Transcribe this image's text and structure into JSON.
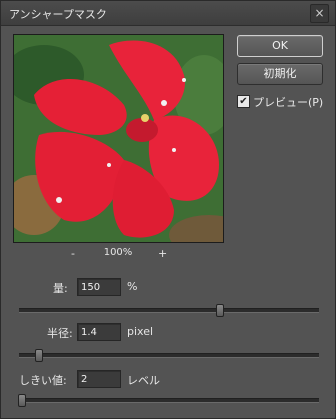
{
  "dialog": {
    "title": "アンシャープマスク",
    "close_glyph": "×"
  },
  "buttons": {
    "ok": "OK",
    "reset": "初期化"
  },
  "preview_toggle": {
    "label": "プレビュー(P)",
    "checked": true,
    "check_glyph": "✔"
  },
  "zoom": {
    "minus": "-",
    "level": "100%",
    "plus": "+"
  },
  "amount": {
    "label": "量:",
    "value": "150",
    "unit": "%",
    "slider_fraction": 0.67
  },
  "radius": {
    "label": "半径:",
    "value": "1.4",
    "unit": "pixel",
    "slider_fraction": 0.065
  },
  "threshold": {
    "label": "しきい値:",
    "value": "2",
    "unit": "レベル",
    "slider_fraction": 0.01
  },
  "colors": {
    "panel": "#535353",
    "flower_red": "#e8233a",
    "foliage": "#3e6e34"
  }
}
